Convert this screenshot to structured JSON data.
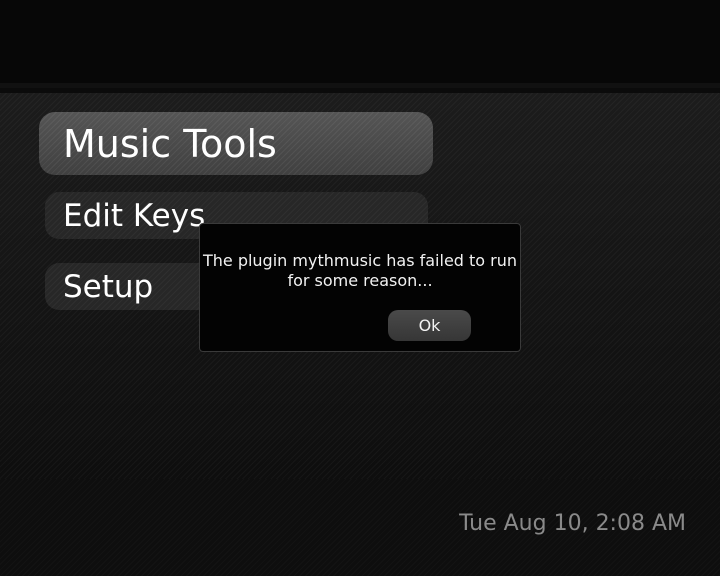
{
  "menu": {
    "items": [
      {
        "label": "Music Tools",
        "selected": true
      },
      {
        "label": "Edit Keys",
        "selected": false
      },
      {
        "label": "Setup",
        "selected": false
      }
    ]
  },
  "dialog": {
    "message": "The plugin mythmusic has failed to run for some reason...",
    "ok_label": "Ok"
  },
  "status": {
    "datetime": "Tue Aug 10, 2:08 AM"
  }
}
